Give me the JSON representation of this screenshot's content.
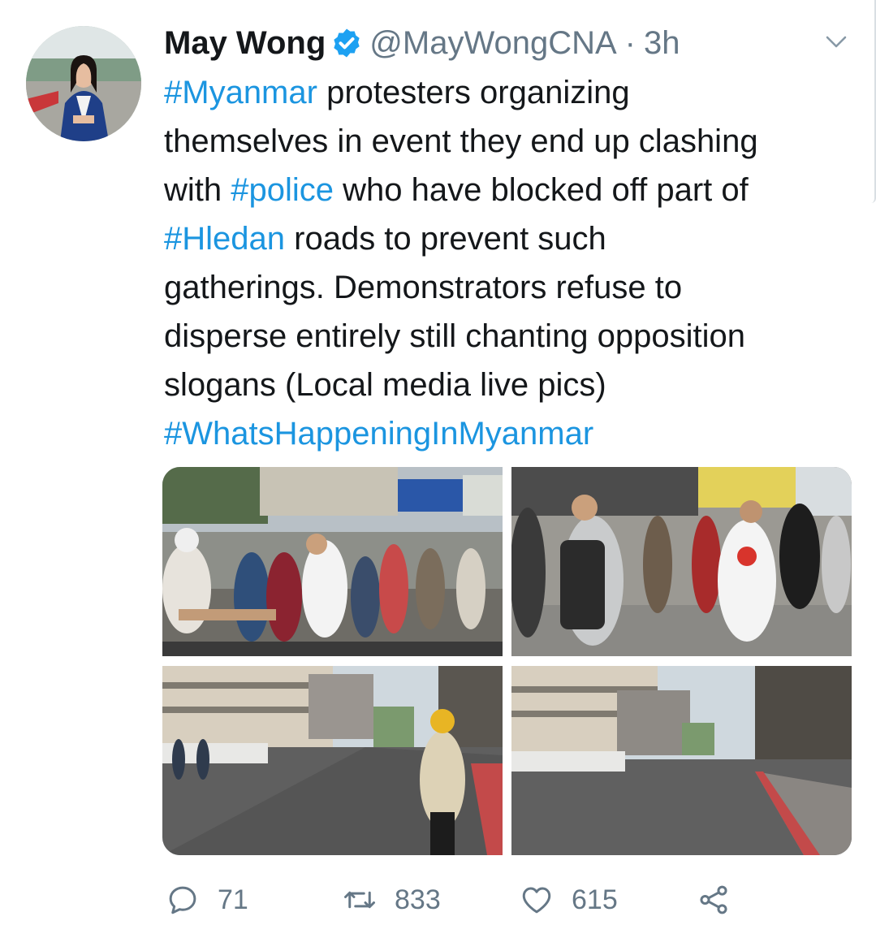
{
  "tweet": {
    "author": {
      "display_name": "May Wong",
      "handle": "@MayWongCNA",
      "separator": "·",
      "timestamp": "3h",
      "verified_icon": "verified-badge-icon",
      "avatar": "avatar"
    },
    "text_lines": [
      [
        {
          "t": "#Myanmar",
          "h": true
        },
        {
          "t": " protesters organizing",
          "h": false
        }
      ],
      [
        {
          "t": "themselves in event they end up clashing",
          "h": false
        }
      ],
      [
        {
          "t": "with ",
          "h": false
        },
        {
          "t": "#police",
          "h": true
        },
        {
          "t": " who have blocked off part of",
          "h": false
        }
      ],
      [
        {
          "t": "#Hledan",
          "h": true
        },
        {
          "t": " roads to prevent such",
          "h": false
        }
      ],
      [
        {
          "t": "gatherings. Demonstrators refuse to",
          "h": false
        }
      ],
      [
        {
          "t": "disperse entirely still chanting opposition",
          "h": false
        }
      ],
      [
        {
          "t": "slogans (Local media live pics)",
          "h": false
        }
      ],
      [
        {
          "t": "#WhatsHappeningInMyanmar",
          "h": true
        }
      ]
    ],
    "media": [
      {
        "name": "photo-protesters-handshake"
      },
      {
        "name": "photo-protesters-holding-hands"
      },
      {
        "name": "photo-empty-street-worker"
      },
      {
        "name": "photo-empty-street"
      }
    ],
    "actions": {
      "reply_count": "71",
      "retweet_count": "833",
      "like_count": "615"
    }
  },
  "colors": {
    "hashtag": "#1b95e0",
    "verified": "#1da1f2",
    "muted": "#657786",
    "text": "#14171a"
  }
}
